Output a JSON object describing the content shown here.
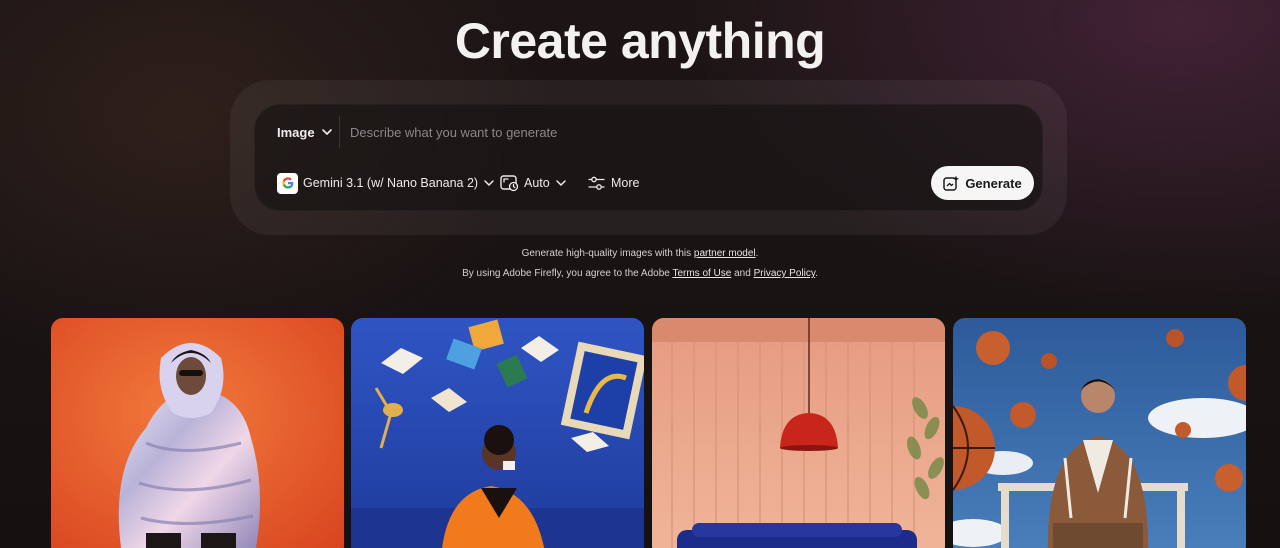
{
  "page": {
    "title": "Create anything"
  },
  "prompt": {
    "type_label": "Image",
    "placeholder": "Describe what you want to generate",
    "model_label": "Gemini 3.1 (w/ Nano Banana 2)",
    "ratio_label": "Auto",
    "more_label": "More",
    "generate_label": "Generate"
  },
  "notes": {
    "line1_prefix": "Generate high-quality images with this ",
    "line1_link": "partner model",
    "line1_suffix": ".",
    "line2_prefix": "By using Adobe Firefly, you agree to the Adobe ",
    "line2_link1": "Terms of Use",
    "line2_mid": " and ",
    "line2_link2": "Privacy Policy",
    "line2_suffix": "."
  },
  "icons": {
    "type_chevron": "chevron-down-icon",
    "model_logo": "google-logo-icon",
    "ratio_icon": "aspect-ratio-icon",
    "more_icon": "sliders-icon",
    "generate_icon": "generate-sparkle-icon"
  },
  "gallery": {
    "items": [
      {
        "name": "gallery-image-puffer-jacket",
        "accent": "#e8562a"
      },
      {
        "name": "gallery-image-flying-books",
        "accent": "#2848b0"
      },
      {
        "name": "gallery-image-pendant-lamp-room",
        "accent": "#e9a88c"
      },
      {
        "name": "gallery-image-basketball-sky",
        "accent": "#3a6aa8"
      }
    ]
  },
  "colors": {
    "background": "#1a1414",
    "generate_button": "#f7f6f6"
  }
}
